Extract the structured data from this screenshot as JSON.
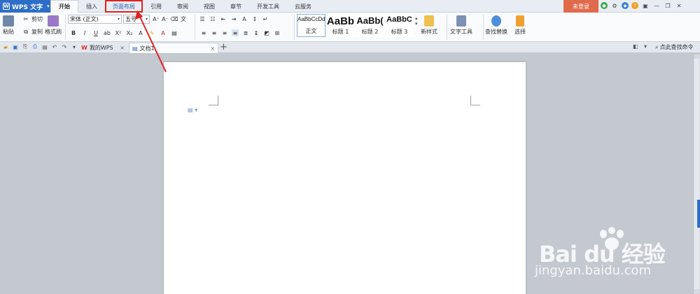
{
  "app": {
    "name": "WPS 文字"
  },
  "menu_tabs": [
    {
      "label": "开始"
    },
    {
      "label": "插入"
    },
    {
      "label": "页面布局"
    },
    {
      "label": "引用"
    },
    {
      "label": "审阅"
    },
    {
      "label": "视图"
    },
    {
      "label": "章节"
    },
    {
      "label": "开发工具"
    },
    {
      "label": "云服务"
    }
  ],
  "login_label": "未登录",
  "ribbon": {
    "paste": "粘贴",
    "cut": "剪切",
    "copy": "复制",
    "format_painter": "格式刷",
    "font_name": "宋体 (正文)",
    "font_size": "五号",
    "new_style": "新样式",
    "text_tools": "文字工具",
    "find_replace": "查找替换",
    "select": "选择",
    "styles": [
      {
        "sample": "AaBbCcDd",
        "name": "正文"
      },
      {
        "sample": "AaBb",
        "name": "标题 1"
      },
      {
        "sample": "AaBb(",
        "name": "标题 2"
      },
      {
        "sample": "AaBbC",
        "name": "标题 3"
      }
    ]
  },
  "doc_tabs": [
    {
      "label": "我的WPS"
    },
    {
      "label": "文档1"
    }
  ],
  "search_command": "点此查找命令",
  "watermark": {
    "logo": "Bai du 经验",
    "url": "jingyan.baidu.com"
  },
  "colors": {
    "accent": "#2d6ec8",
    "login": "#e06a4c",
    "annotation": "#e02020"
  }
}
